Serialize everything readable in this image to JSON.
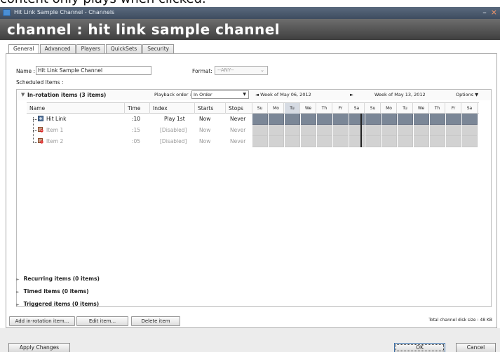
{
  "overflow_text": "content only plays when clicked.",
  "window": {
    "title": "Hit Link Sample Channel - Channels",
    "minimize": "–",
    "close": "×"
  },
  "banner": {
    "heading": "channel : hit link sample channel"
  },
  "tabs": [
    "General",
    "Advanced",
    "Players",
    "QuickSets",
    "Security"
  ],
  "form": {
    "name_label": "Name :",
    "name_value": "Hit Link Sample Channel",
    "format_label": "Format:",
    "format_value": "--ANY--",
    "scheduled_label": "Scheduled Items :"
  },
  "rotation": {
    "title": "In-rotation items (3 items)",
    "playback_label": "Playback order :",
    "playback_value": "In Order",
    "week1": "◄ Week of May 06, 2012",
    "next_arrow": "►",
    "week2": "Week of May 13, 2012",
    "options": "Options ▼",
    "columns": {
      "name": "Name",
      "time": "Time",
      "index": "Index",
      "starts": "Starts",
      "stops": "Stops"
    },
    "days": [
      "Su",
      "Mo",
      "Tu",
      "We",
      "Th",
      "Fr",
      "Sa",
      "Su",
      "Mo",
      "Tu",
      "We",
      "Th",
      "Fr",
      "Sa"
    ],
    "today_index": 2,
    "rows": [
      {
        "name": "Hit Link",
        "time": ":10",
        "index": "Play 1st",
        "starts": "Now",
        "stops": "Never",
        "disabled": false
      },
      {
        "name": "Item 1",
        "time": ":15",
        "index": "[Disabled]",
        "starts": "Now",
        "stops": "Never",
        "disabled": true
      },
      {
        "name": "Item 2",
        "time": ":05",
        "index": "[Disabled]",
        "starts": "Now",
        "stops": "Never",
        "disabled": true
      }
    ]
  },
  "collapsed_sections": {
    "recurring": "Recurring items (0 items)",
    "timed": "Timed items (0 items)",
    "triggered": "Triggered items (0 items)"
  },
  "actions": {
    "add": "Add in-rotation item...",
    "edit": "Edit item...",
    "delete": "Delete item"
  },
  "disk_size": "Total channel disk size : 48 KB",
  "footer": {
    "apply": "Apply Changes",
    "ok": "OK",
    "cancel": "Cancel"
  },
  "colors": {
    "banner": "#4a4a4a",
    "active_day_row": "#7b8797",
    "disabled_day_row": "#d2d2d2",
    "titlebar": "#4a5a6e"
  },
  "icons": [
    "app-icon",
    "link-icon",
    "item-disabled-icon",
    "triangle-expanded-icon",
    "triangle-collapsed-icon"
  ]
}
